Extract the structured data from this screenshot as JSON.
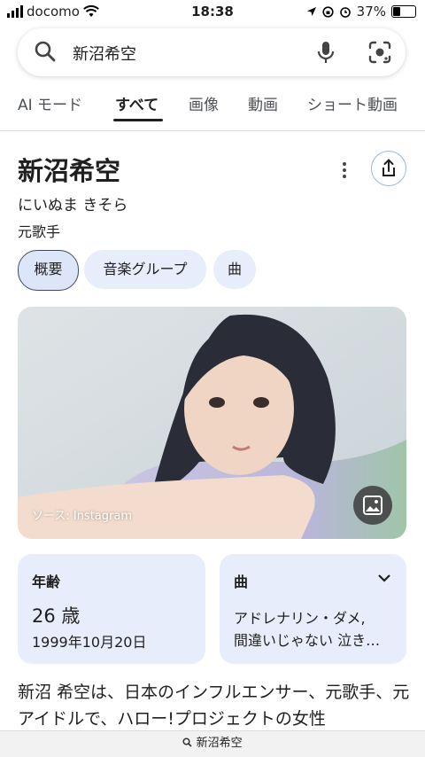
{
  "status_bar": {
    "carrier": "docomo",
    "time": "18:38",
    "battery": "37%",
    "battery_level": 0.37
  },
  "search": {
    "query": "新沼希空"
  },
  "tabs": [
    "AI モード",
    "すべて",
    "画像",
    "動画",
    "ショート動画"
  ],
  "active_tab": "すべて",
  "entity": {
    "name": "新沼希空",
    "reading": "にいぬま きそら",
    "description": "元歌手"
  },
  "chips": [
    "概要",
    "音楽グループ",
    "曲"
  ],
  "photo": {
    "source": "ソース: Instagram"
  },
  "age_card": {
    "label": "年齢",
    "age": "26 歳",
    "birthdate": "1999年10月20日"
  },
  "songs_card": {
    "label": "曲",
    "line1": "アドレナリン・ダメ,",
    "line2": "間違いじゃない 泣き虫の僕に..."
  },
  "summary": "新沼 希空は、日本のインフルエンサー、元歌手、元アイドルで、ハロー!プロジェクトの女性",
  "bottom_bar": {
    "query": "新沼希空"
  },
  "colors": {
    "chip_bg": "#e8edfb",
    "text": "#1f1f1f",
    "secondary": "#4d5156"
  }
}
